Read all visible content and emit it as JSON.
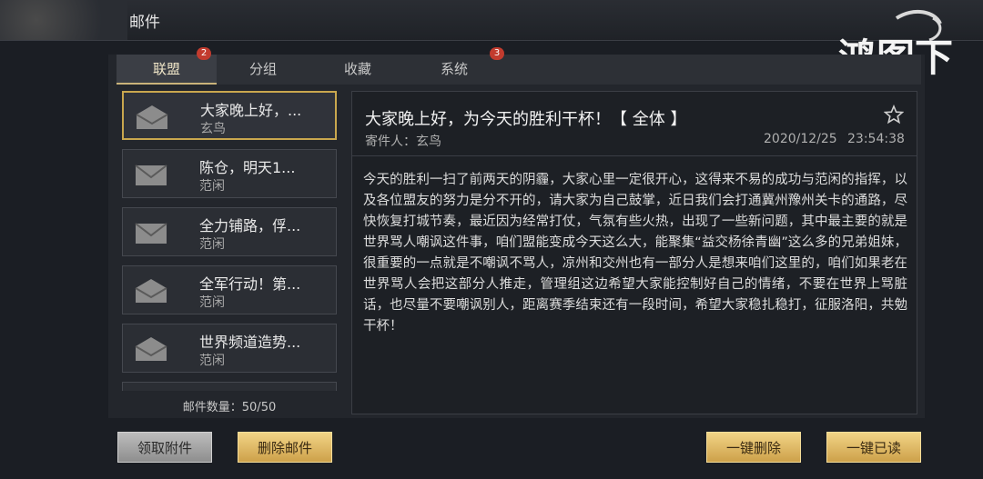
{
  "header": {
    "title": "邮件"
  },
  "logo": {
    "text": "鸿图之下"
  },
  "tabs": [
    {
      "label": "联盟",
      "badge": "2"
    },
    {
      "label": "分组",
      "badge": ""
    },
    {
      "label": "收藏",
      "badge": ""
    },
    {
      "label": "系统",
      "badge": "3"
    }
  ],
  "mail_list": [
    {
      "subject": "大家晚上好，...",
      "sender": "玄鸟"
    },
    {
      "subject": "陈仓，明天1...",
      "sender": "范闲"
    },
    {
      "subject": "全力铺路，俘...",
      "sender": "范闲"
    },
    {
      "subject": "全军行动！第...",
      "sender": "范闲"
    },
    {
      "subject": "世界频道造势...",
      "sender": "范闲"
    }
  ],
  "mail_count": "邮件数量：50/50",
  "detail": {
    "title": "大家晚上好，为今天的胜利干杯！【 全体 】",
    "sender": "寄件人：玄鸟",
    "date": "2020/12/25",
    "time": "23:54:38",
    "body": "今天的胜利一扫了前两天的阴霾，大家心里一定很开心，这得来不易的成功与范闲的指挥，以及各位盟友的努力是分不开的，请大家为自己鼓掌，近日我们会打通冀州豫州关卡的通路，尽快恢复打城节奏，最近因为经常打仗，气氛有些火热，出现了一些新问题，其中最主要的就是世界骂人嘲讽这件事，咱们盟能变成今天这么大，能聚集“益交杨徐青幽”这么多的兄弟姐妹，很重要的一点就是不嘲讽不骂人，凉州和交州也有一部分人是想来咱们这里的，咱们如果老在世界骂人会把这部分人推走，管理组这边希望大家能控制好自己的情绪，不要在世界上骂脏话，也尽量不要嘲讽别人，距离赛季结束还有一段时间，希望大家稳扎稳打，征服洛阳，共勉干杯！"
  },
  "buttons": {
    "collect": "领取附件",
    "delete_mail": "删除邮件",
    "delete_all": "一键删除",
    "read_all": "一键已读"
  },
  "colors": {
    "accent_gold": "#c9a74e",
    "badge_red": "#c23b2e"
  }
}
